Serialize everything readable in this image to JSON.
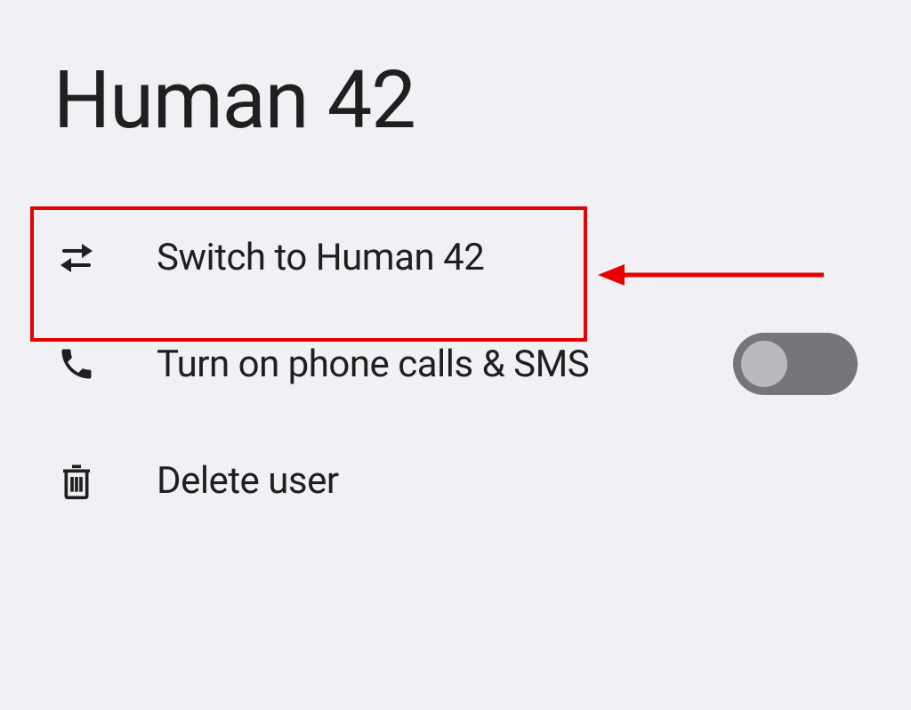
{
  "title": "Human 42",
  "options": {
    "switch": {
      "label": "Switch to Human 42"
    },
    "phone": {
      "label": "Turn on phone calls & SMS",
      "toggled": false
    },
    "delete": {
      "label": "Delete user"
    }
  },
  "annotation": {
    "highlight_target": "switch-user-row"
  }
}
